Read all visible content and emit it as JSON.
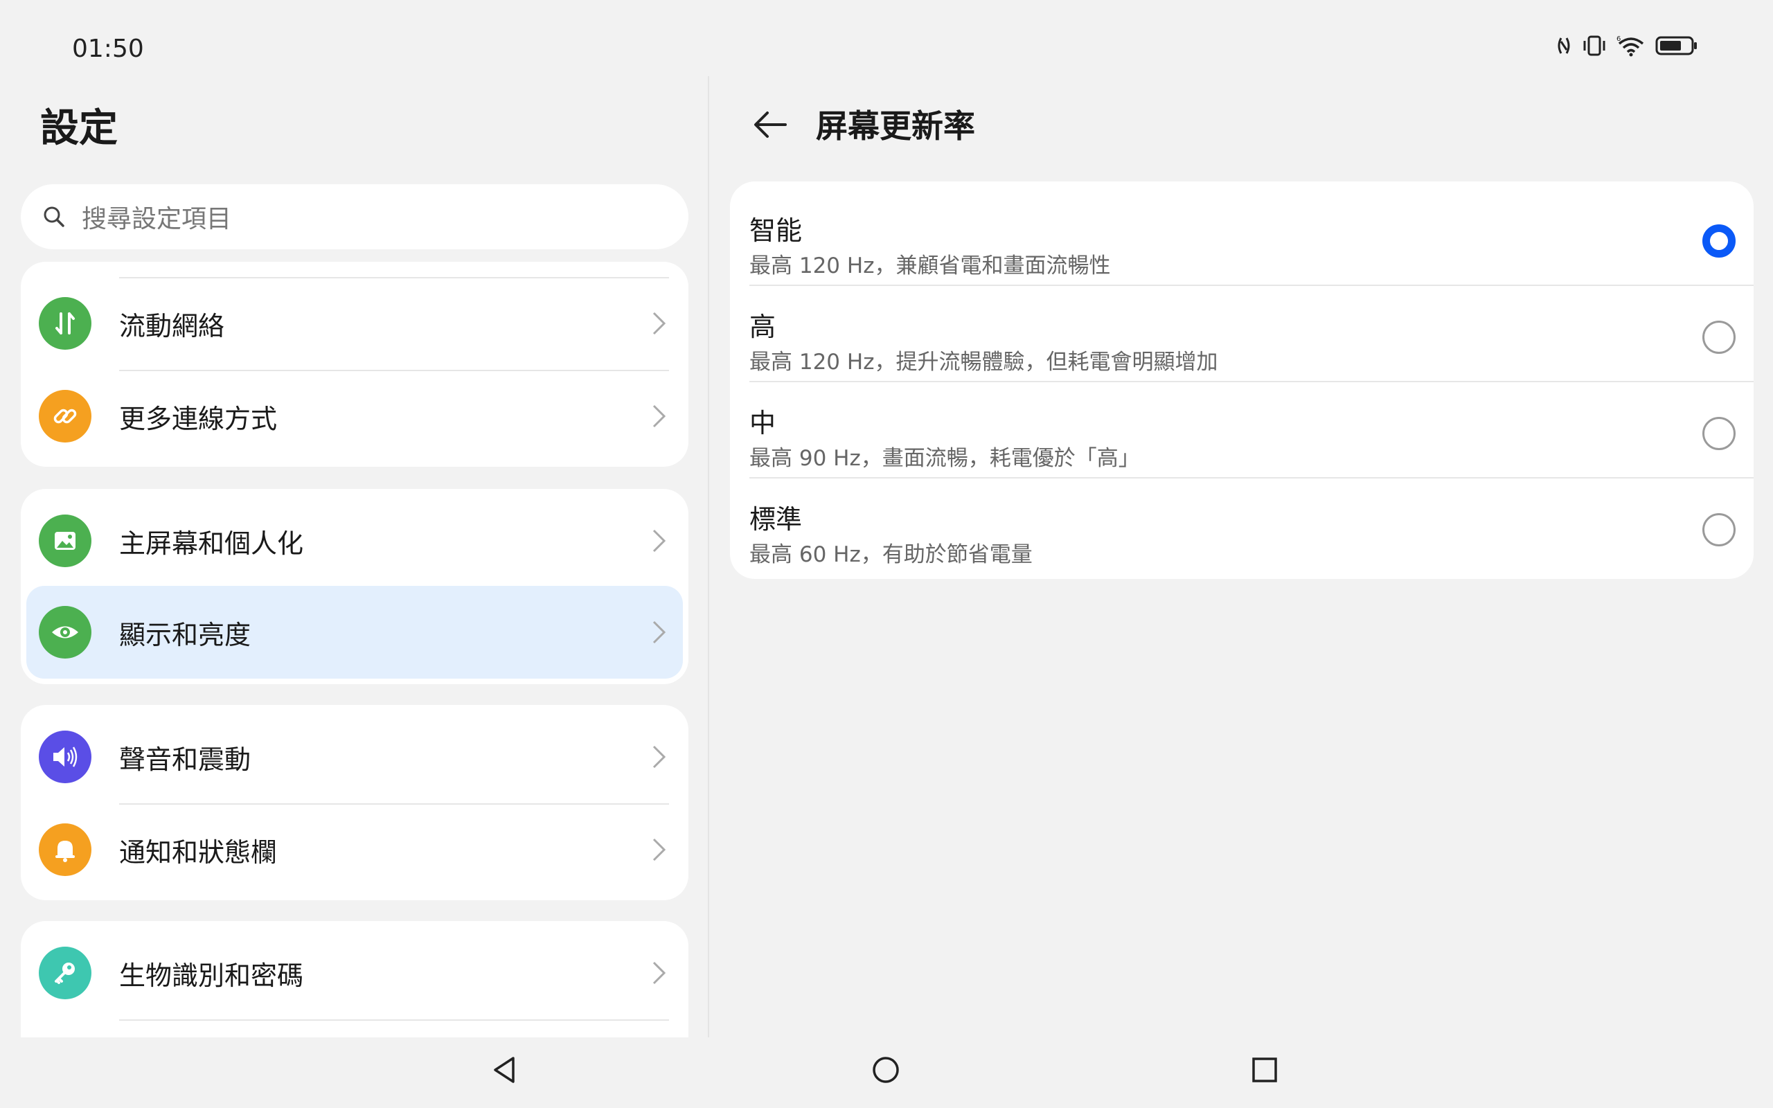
{
  "status_bar": {
    "time": "01:50",
    "wifi_badge": "6"
  },
  "left": {
    "title": "設定",
    "search_placeholder": "搜尋設定項目",
    "groups": [
      {
        "items": [
          {
            "label": "流動網絡",
            "icon": "mobile-data-icon",
            "color": "#4cb050"
          },
          {
            "label": "更多連線方式",
            "icon": "link-icon",
            "color": "#f5a020"
          }
        ]
      },
      {
        "items": [
          {
            "label": "主屏幕和個人化",
            "icon": "image-icon",
            "color": "#4cb050"
          },
          {
            "label": "顯示和亮度",
            "icon": "eye-icon",
            "color": "#4cb050",
            "selected": true
          }
        ]
      },
      {
        "items": [
          {
            "label": "聲音和震動",
            "icon": "speaker-icon",
            "color": "#5a4ee6"
          },
          {
            "label": "通知和狀態欄",
            "icon": "bell-icon",
            "color": "#f5a020"
          }
        ]
      },
      {
        "items": [
          {
            "label": "生物識別和密碼",
            "icon": "key-icon",
            "color": "#3ec7b0"
          }
        ]
      }
    ]
  },
  "right": {
    "title": "屏幕更新率",
    "options": [
      {
        "title": "智能",
        "subtitle": "最高 120 Hz，兼顧省電和畫面流暢性",
        "selected": true
      },
      {
        "title": "高",
        "subtitle": "最高 120 Hz，提升流暢體驗，但耗電會明顯增加",
        "selected": false
      },
      {
        "title": "中",
        "subtitle": "最高 90 Hz，畫面流暢，耗電優於「高」",
        "selected": false
      },
      {
        "title": "標準",
        "subtitle": "最高 60 Hz，有助於節省電量",
        "selected": false
      }
    ]
  },
  "colors": {
    "accent": "#0a59f7",
    "selected_row": "#e3effd",
    "background": "#f2f2f2"
  }
}
